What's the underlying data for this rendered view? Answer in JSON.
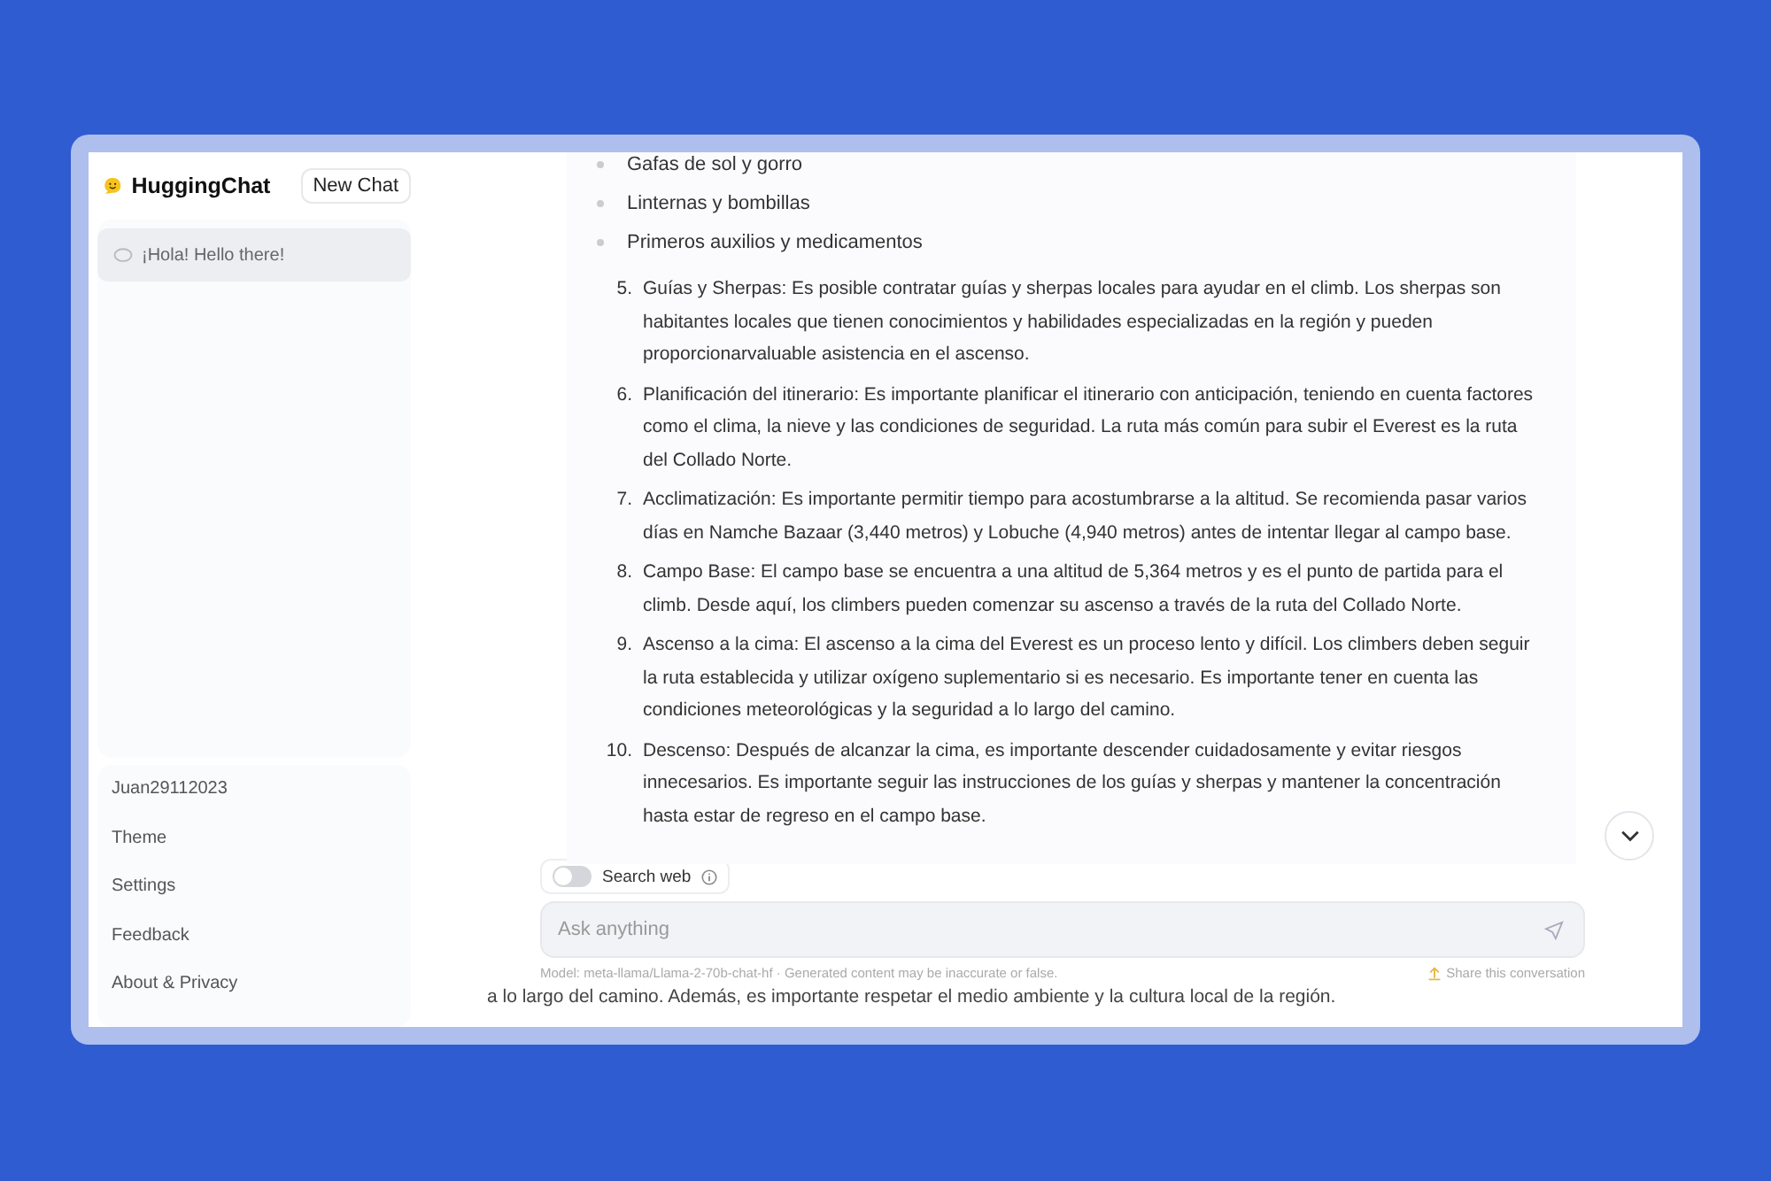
{
  "sidebar": {
    "app_name": "HuggingChat",
    "new_chat_button": "New Chat",
    "conversations": [
      {
        "title": "¡Hola! Hello there!",
        "selected": true
      }
    ],
    "user": "Juan29112023",
    "menu": [
      "Theme",
      "Settings",
      "Feedback",
      "About & Privacy"
    ]
  },
  "message": {
    "bullets": [
      "Gafas de sol y gorro",
      "Linternas y bombillas",
      "Primeros auxilios y medicamentos"
    ],
    "steps": [
      {
        "number": "5.",
        "text": "Guías y Sherpas: Es posible contratar guías y sherpas locales para ayudar en el climb. Los sherpas son habitantes locales que tienen conocimientos y habilidades especializadas en la región y pueden proporcionarvaluable asistencia en el ascenso."
      },
      {
        "number": "6.",
        "text": "Planificación del itinerario: Es importante planificar el itinerario con anticipación, teniendo en cuenta factores como el clima, la nieve y las condiciones de seguridad. La ruta más común para subir el Everest es la ruta del Collado Norte."
      },
      {
        "number": "7.",
        "text": "Acclimatización: Es importante permitir tiempo para acostumbrarse a la altitud. Se recomienda pasar varios días en Namche Bazaar (3,440 metros) y Lobuche (4,940 metros) antes de intentar llegar al campo base."
      },
      {
        "number": "8.",
        "text": "Campo Base: El campo base se encuentra a una altitud de 5,364 metros y es el punto de partida para el climb. Desde aquí, los climbers pueden comenzar su ascenso a través de la ruta del Collado Norte."
      },
      {
        "number": "9.",
        "text": "Ascenso a la cima: El ascenso a la cima del Everest es un proceso lento y difícil. Los climbers deben seguir la ruta establecida y utilizar oxígeno suplementario si es necesario. Es importante tener en cuenta las condiciones meteorológicas y la seguridad a lo largo del camino."
      },
      {
        "number": "10.",
        "text": "Descenso: Después de alcanzar la cima, es importante descender cuidadosamente y evitar riesgos innecesarios. Es importante seguir las instrucciones de los guías y sherpas y mantener la concentración hasta estar de regreso en el campo base."
      }
    ],
    "tail": "a lo largo del camino. Además, es importante respetar el medio ambiente y la cultura local de la región."
  },
  "search_web": {
    "label": "Search web",
    "on": false
  },
  "input": {
    "placeholder": "Ask anything"
  },
  "footer": {
    "model_note": "Model: meta-llama/Llama-2-70b-chat-hf · Generated content may be inaccurate or false.",
    "share_link": "Share this conversation"
  }
}
